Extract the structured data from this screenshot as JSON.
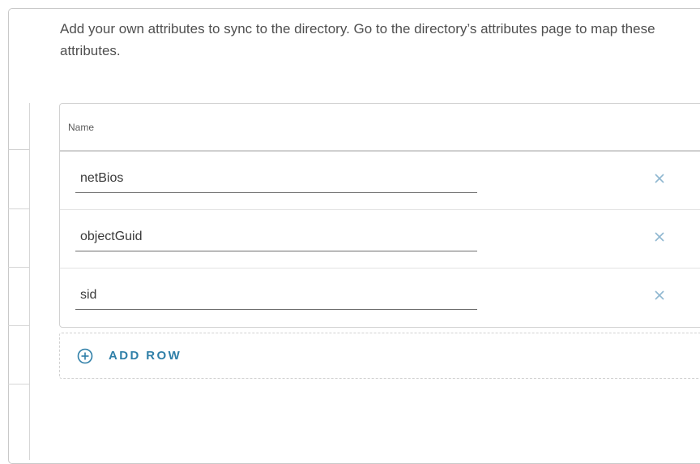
{
  "description": "Add your own attributes to sync to the directory. Go to the directory’s attributes page to map these attributes.",
  "table": {
    "column_header": "Name",
    "rows": [
      {
        "value": "netBios"
      },
      {
        "value": "objectGuid"
      },
      {
        "value": "sid"
      }
    ],
    "remove_icon": "close-icon"
  },
  "add_row": {
    "label": "ADD ROW",
    "icon": "plus-circle-icon"
  },
  "colors": {
    "accent": "#2f7fa8",
    "remove_icon": "#8fb7d0",
    "border": "#d2d2d2"
  }
}
